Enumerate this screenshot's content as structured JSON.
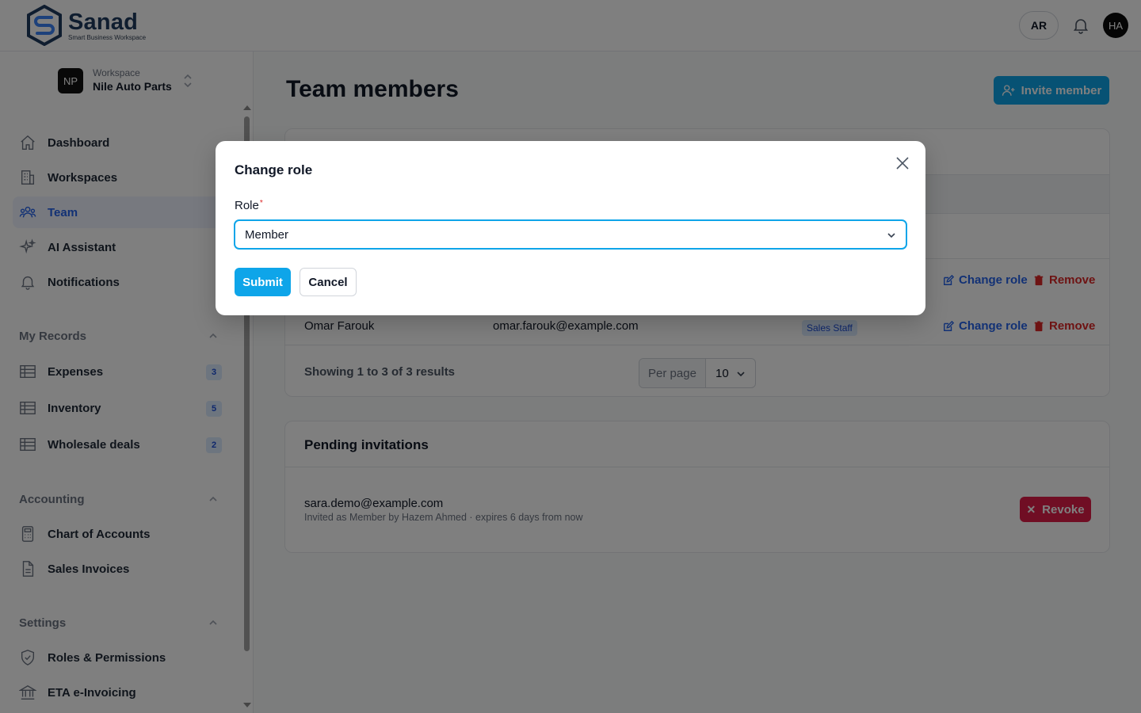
{
  "brand": {
    "name": "Sanad",
    "tagline": "Smart Business Workspace"
  },
  "topbar": {
    "lang": "AR",
    "avatar": "HA"
  },
  "workspace": {
    "badge": "NP",
    "label": "Workspace",
    "name": "Nile Auto Parts"
  },
  "nav": {
    "main": [
      {
        "label": "Dashboard",
        "icon": "home-icon"
      },
      {
        "label": "Workspaces",
        "icon": "building-icon"
      },
      {
        "label": "Team",
        "icon": "users-icon",
        "active": true
      },
      {
        "label": "AI Assistant",
        "icon": "sparkles-icon"
      },
      {
        "label": "Notifications",
        "icon": "bell-icon"
      }
    ],
    "sections": [
      {
        "title": "My Records",
        "items": [
          {
            "label": "Expenses",
            "count": "3"
          },
          {
            "label": "Inventory",
            "count": "5"
          },
          {
            "label": "Wholesale deals",
            "count": "2"
          }
        ]
      },
      {
        "title": "Accounting",
        "items": [
          {
            "label": "Chart of Accounts"
          },
          {
            "label": "Sales Invoices"
          }
        ]
      },
      {
        "title": "Settings",
        "items": [
          {
            "label": "Roles & Permissions"
          },
          {
            "label": "ETA e-Invoicing"
          }
        ]
      }
    ]
  },
  "main": {
    "title": "Team members",
    "invite_label": "Invite member",
    "members": [
      {
        "name": "",
        "email": "",
        "role": "",
        "change": "Change role",
        "remove": "Remove"
      },
      {
        "name": "Omar Farouk",
        "email": "omar.farouk@example.com",
        "role": "Sales Staff",
        "change": "Change role",
        "remove": "Remove"
      }
    ],
    "showing": "Showing 1 to 3 of 3 results",
    "per_page_label": "Per page",
    "per_page_value": "10"
  },
  "pending": {
    "title": "Pending invitations",
    "email": "sara.demo@example.com",
    "meta": "Invited as Member by Hazem Ahmed · expires 6 days from now",
    "revoke_label": "Revoke"
  },
  "modal": {
    "title": "Change role",
    "field_label": "Role",
    "required_mark": "*",
    "selected_role": "Member",
    "submit_label": "Submit",
    "cancel_label": "Cancel"
  },
  "colors": {
    "accent": "#0ea5e9",
    "danger": "#e11d48",
    "link": "#2563eb"
  }
}
